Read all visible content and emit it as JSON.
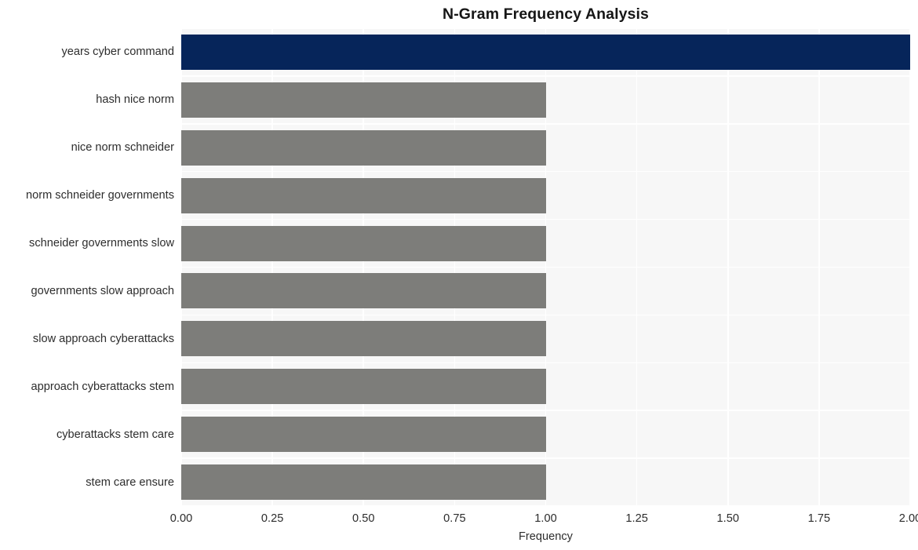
{
  "chart_data": {
    "type": "bar",
    "orientation": "horizontal",
    "title": "N-Gram Frequency Analysis",
    "xlabel": "Frequency",
    "ylabel": "",
    "xlim": [
      0,
      2.0
    ],
    "xticks": [
      0,
      0.25,
      0.5,
      0.75,
      1.0,
      1.25,
      1.5,
      1.75,
      2.0
    ],
    "xticklabels": [
      "0.00",
      "0.25",
      "0.50",
      "0.75",
      "1.00",
      "1.25",
      "1.50",
      "1.75",
      "2.00"
    ],
    "grid": true,
    "legend": false,
    "categories": [
      "years cyber command",
      "hash nice norm",
      "nice norm schneider",
      "norm schneider governments",
      "schneider governments slow",
      "governments slow approach",
      "slow approach cyberattacks",
      "approach cyberattacks stem",
      "cyberattacks stem care",
      "stem care ensure"
    ],
    "values": [
      2,
      1,
      1,
      1,
      1,
      1,
      1,
      1,
      1,
      1
    ],
    "bar_colors": [
      "#06255a",
      "#7d7d7a",
      "#7d7d7a",
      "#7d7d7a",
      "#7d7d7a",
      "#7d7d7a",
      "#7d7d7a",
      "#7d7d7a",
      "#7d7d7a",
      "#7d7d7a"
    ],
    "colors": {
      "highlight_bar": "#06255a",
      "default_bar": "#7d7d7a",
      "plot_background": "#f7f7f7",
      "figure_background": "#ffffff",
      "gridline": "#ffffff",
      "title_text": "#161616",
      "tick_text": "#2d2d2d"
    }
  }
}
